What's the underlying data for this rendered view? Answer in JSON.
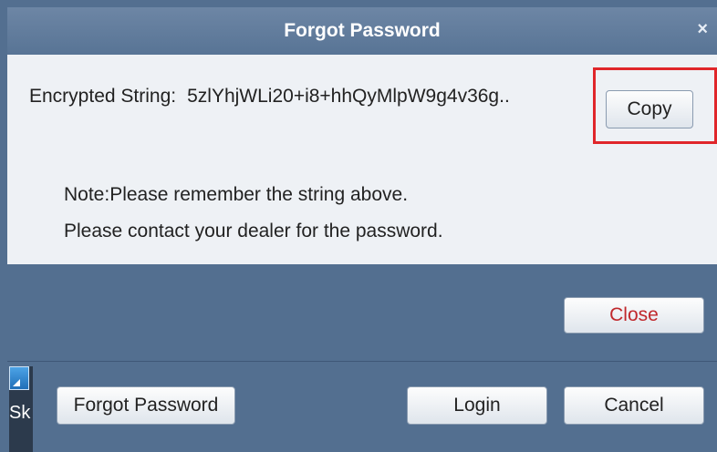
{
  "dialog": {
    "title": "Forgot Password",
    "close_glyph": "×",
    "encrypted_label": "Encrypted String:",
    "encrypted_value": "5zlYhjWLi20+i8+hhQyMlpW9g4v36g..",
    "copy_label": "Copy",
    "note_line1": "Note:Please remember the string above.",
    "note_line2": "Please contact your dealer for the password.",
    "close_label": "Close"
  },
  "background": {
    "shortcut_label": "Sk",
    "shortcut_icon": "app-shortcut-icon",
    "forgot_password_label": "Forgot Password",
    "login_label": "Login",
    "cancel_label": "Cancel"
  },
  "colors": {
    "highlight": "#e0262a",
    "title_bar": "#5f7b9c",
    "content_bg": "#eef1f5",
    "close_text": "#c0282c"
  }
}
